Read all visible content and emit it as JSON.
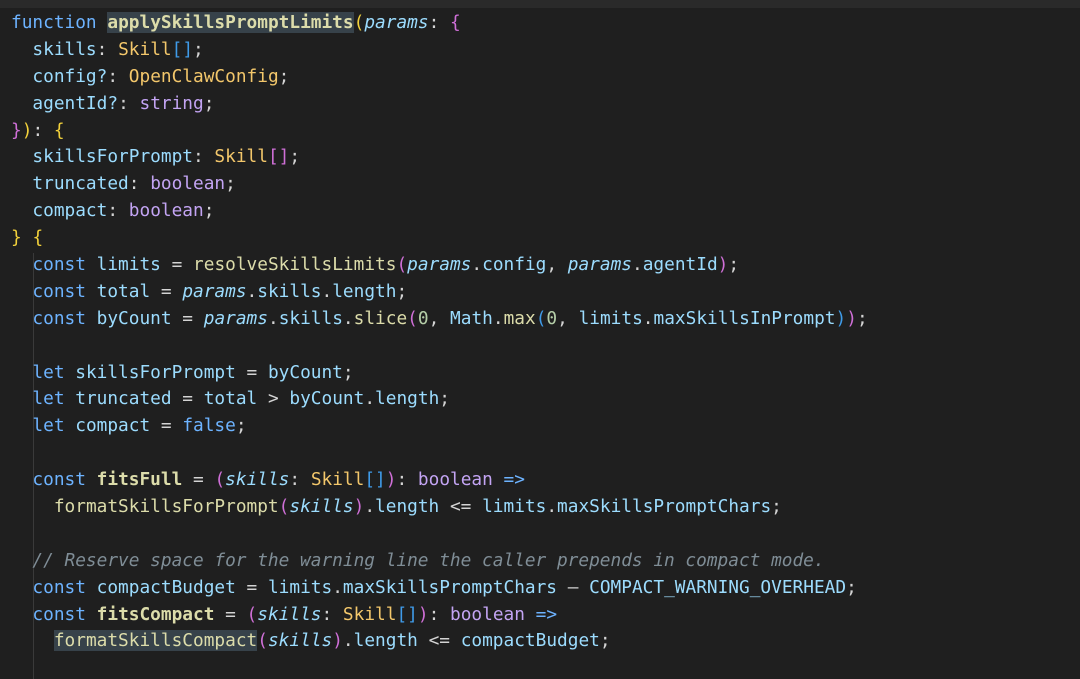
{
  "theme": {
    "background": "#1f1f1f",
    "keyword": "#6db3ff",
    "function": "#dcdcaa",
    "variable": "#9cdcfe",
    "type": "#f3c76b",
    "comment": "#7f8d96"
  },
  "lines": [
    [
      {
        "t": "function",
        "c": "kw2"
      },
      {
        "t": " ",
        "c": "pu"
      },
      {
        "t": "applySkillsPromptLimits",
        "c": "fnb hl"
      },
      {
        "t": "(",
        "c": "br1"
      },
      {
        "t": "params",
        "c": "param"
      },
      {
        "t": ": ",
        "c": "pu"
      },
      {
        "t": "{",
        "c": "br2"
      }
    ],
    [
      {
        "t": "  skills",
        "c": "var"
      },
      {
        "t": ": ",
        "c": "pu"
      },
      {
        "t": "Skill",
        "c": "type"
      },
      {
        "t": "[]",
        "c": "br3"
      },
      {
        "t": ";",
        "c": "pu"
      }
    ],
    [
      {
        "t": "  config?",
        "c": "var"
      },
      {
        "t": ": ",
        "c": "pu"
      },
      {
        "t": "OpenClawConfig",
        "c": "type"
      },
      {
        "t": ";",
        "c": "pu"
      }
    ],
    [
      {
        "t": "  agentId?",
        "c": "var"
      },
      {
        "t": ": ",
        "c": "pu"
      },
      {
        "t": "string",
        "c": "ty2"
      },
      {
        "t": ";",
        "c": "pu"
      }
    ],
    [
      {
        "t": "}",
        "c": "br2"
      },
      {
        "t": ")",
        "c": "br1"
      },
      {
        "t": ": ",
        "c": "pu"
      },
      {
        "t": "{",
        "c": "br1"
      }
    ],
    [
      {
        "t": "  skillsForPrompt",
        "c": "var"
      },
      {
        "t": ": ",
        "c": "pu"
      },
      {
        "t": "Skill",
        "c": "type"
      },
      {
        "t": "[]",
        "c": "br2"
      },
      {
        "t": ";",
        "c": "pu"
      }
    ],
    [
      {
        "t": "  truncated",
        "c": "var"
      },
      {
        "t": ": ",
        "c": "pu"
      },
      {
        "t": "boolean",
        "c": "ty2"
      },
      {
        "t": ";",
        "c": "pu"
      }
    ],
    [
      {
        "t": "  compact",
        "c": "var"
      },
      {
        "t": ": ",
        "c": "pu"
      },
      {
        "t": "boolean",
        "c": "ty2"
      },
      {
        "t": ";",
        "c": "pu"
      }
    ],
    [
      {
        "t": "}",
        "c": "br1"
      },
      {
        "t": " ",
        "c": "pu"
      },
      {
        "t": "{",
        "c": "br1"
      }
    ],
    [
      {
        "t": "  const",
        "c": "kw2"
      },
      {
        "t": " limits ",
        "c": "var"
      },
      {
        "t": "=",
        "c": "pu"
      },
      {
        "t": " ",
        "c": "pu"
      },
      {
        "t": "resolveSkillsLimits",
        "c": "fn"
      },
      {
        "t": "(",
        "c": "br2"
      },
      {
        "t": "params",
        "c": "param"
      },
      {
        "t": ".",
        "c": "pu"
      },
      {
        "t": "config",
        "c": "var"
      },
      {
        "t": ", ",
        "c": "pu"
      },
      {
        "t": "params",
        "c": "param"
      },
      {
        "t": ".",
        "c": "pu"
      },
      {
        "t": "agentId",
        "c": "var"
      },
      {
        "t": ")",
        "c": "br2"
      },
      {
        "t": ";",
        "c": "pu"
      }
    ],
    [
      {
        "t": "  const",
        "c": "kw2"
      },
      {
        "t": " total ",
        "c": "var"
      },
      {
        "t": "=",
        "c": "pu"
      },
      {
        "t": " ",
        "c": "pu"
      },
      {
        "t": "params",
        "c": "param"
      },
      {
        "t": ".",
        "c": "pu"
      },
      {
        "t": "skills",
        "c": "var"
      },
      {
        "t": ".",
        "c": "pu"
      },
      {
        "t": "length",
        "c": "var"
      },
      {
        "t": ";",
        "c": "pu"
      }
    ],
    [
      {
        "t": "  const",
        "c": "kw2"
      },
      {
        "t": " byCount ",
        "c": "var"
      },
      {
        "t": "=",
        "c": "pu"
      },
      {
        "t": " ",
        "c": "pu"
      },
      {
        "t": "params",
        "c": "param"
      },
      {
        "t": ".",
        "c": "pu"
      },
      {
        "t": "skills",
        "c": "var"
      },
      {
        "t": ".",
        "c": "pu"
      },
      {
        "t": "slice",
        "c": "fn"
      },
      {
        "t": "(",
        "c": "br2"
      },
      {
        "t": "0",
        "c": "num"
      },
      {
        "t": ", ",
        "c": "pu"
      },
      {
        "t": "Math",
        "c": "var"
      },
      {
        "t": ".",
        "c": "pu"
      },
      {
        "t": "max",
        "c": "fn"
      },
      {
        "t": "(",
        "c": "br3"
      },
      {
        "t": "0",
        "c": "num"
      },
      {
        "t": ", ",
        "c": "pu"
      },
      {
        "t": "limits",
        "c": "var"
      },
      {
        "t": ".",
        "c": "pu"
      },
      {
        "t": "maxSkillsInPrompt",
        "c": "var"
      },
      {
        "t": ")",
        "c": "br3"
      },
      {
        "t": ")",
        "c": "br2"
      },
      {
        "t": ";",
        "c": "pu"
      }
    ],
    [],
    [
      {
        "t": "  let",
        "c": "kw2"
      },
      {
        "t": " skillsForPrompt ",
        "c": "var"
      },
      {
        "t": "=",
        "c": "pu"
      },
      {
        "t": " byCount",
        "c": "var"
      },
      {
        "t": ";",
        "c": "pu"
      }
    ],
    [
      {
        "t": "  let",
        "c": "kw2"
      },
      {
        "t": " truncated ",
        "c": "var"
      },
      {
        "t": "=",
        "c": "pu"
      },
      {
        "t": " total ",
        "c": "var"
      },
      {
        "t": ">",
        "c": "pu"
      },
      {
        "t": " byCount",
        "c": "var"
      },
      {
        "t": ".",
        "c": "pu"
      },
      {
        "t": "length",
        "c": "var"
      },
      {
        "t": ";",
        "c": "pu"
      }
    ],
    [
      {
        "t": "  let",
        "c": "kw2"
      },
      {
        "t": " compact ",
        "c": "var"
      },
      {
        "t": "=",
        "c": "pu"
      },
      {
        "t": " false",
        "c": "bool"
      },
      {
        "t": ";",
        "c": "pu"
      }
    ],
    [],
    [
      {
        "t": "  const",
        "c": "kw2"
      },
      {
        "t": " ",
        "c": "pu"
      },
      {
        "t": "fitsFull",
        "c": "fnb"
      },
      {
        "t": " = ",
        "c": "pu"
      },
      {
        "t": "(",
        "c": "br2"
      },
      {
        "t": "skills",
        "c": "param"
      },
      {
        "t": ": ",
        "c": "pu"
      },
      {
        "t": "Skill",
        "c": "type"
      },
      {
        "t": "[]",
        "c": "br3"
      },
      {
        "t": ")",
        "c": "br2"
      },
      {
        "t": ": ",
        "c": "pu"
      },
      {
        "t": "boolean",
        "c": "ty2"
      },
      {
        "t": " =>",
        "c": "kw2"
      }
    ],
    [
      {
        "t": "    ",
        "c": "pu"
      },
      {
        "t": "formatSkillsForPrompt",
        "c": "fn"
      },
      {
        "t": "(",
        "c": "br2"
      },
      {
        "t": "skills",
        "c": "param"
      },
      {
        "t": ")",
        "c": "br2"
      },
      {
        "t": ".",
        "c": "pu"
      },
      {
        "t": "length",
        "c": "var"
      },
      {
        "t": " <= ",
        "c": "pu"
      },
      {
        "t": "limits",
        "c": "var"
      },
      {
        "t": ".",
        "c": "pu"
      },
      {
        "t": "maxSkillsPromptChars",
        "c": "var"
      },
      {
        "t": ";",
        "c": "pu"
      }
    ],
    [],
    [
      {
        "t": "  // Reserve space for the warning line the caller prepends in compact mode.",
        "c": "cmt"
      }
    ],
    [
      {
        "t": "  const",
        "c": "kw2"
      },
      {
        "t": " compactBudget ",
        "c": "var"
      },
      {
        "t": "=",
        "c": "pu"
      },
      {
        "t": " limits",
        "c": "var"
      },
      {
        "t": ".",
        "c": "pu"
      },
      {
        "t": "maxSkillsPromptChars",
        "c": "var"
      },
      {
        "t": " – ",
        "c": "pu"
      },
      {
        "t": "COMPACT_WARNING_OVERHEAD",
        "c": "var"
      },
      {
        "t": ";",
        "c": "pu"
      }
    ],
    [
      {
        "t": "  const",
        "c": "kw2"
      },
      {
        "t": " ",
        "c": "pu"
      },
      {
        "t": "fitsCompact",
        "c": "fnb"
      },
      {
        "t": " = ",
        "c": "pu"
      },
      {
        "t": "(",
        "c": "br2"
      },
      {
        "t": "skills",
        "c": "param"
      },
      {
        "t": ": ",
        "c": "pu"
      },
      {
        "t": "Skill",
        "c": "type"
      },
      {
        "t": "[]",
        "c": "br3"
      },
      {
        "t": ")",
        "c": "br2"
      },
      {
        "t": ": ",
        "c": "pu"
      },
      {
        "t": "boolean",
        "c": "ty2"
      },
      {
        "t": " =>",
        "c": "kw2"
      }
    ],
    [
      {
        "t": "    ",
        "c": "pu"
      },
      {
        "t": "formatSkillsCompact",
        "c": "fn hl"
      },
      {
        "t": "(",
        "c": "br2"
      },
      {
        "t": "skills",
        "c": "param"
      },
      {
        "t": ")",
        "c": "br2"
      },
      {
        "t": ".",
        "c": "pu"
      },
      {
        "t": "length",
        "c": "var"
      },
      {
        "t": " <= ",
        "c": "pu"
      },
      {
        "t": "compactBudget",
        "c": "var"
      },
      {
        "t": ";",
        "c": "pu"
      }
    ]
  ]
}
